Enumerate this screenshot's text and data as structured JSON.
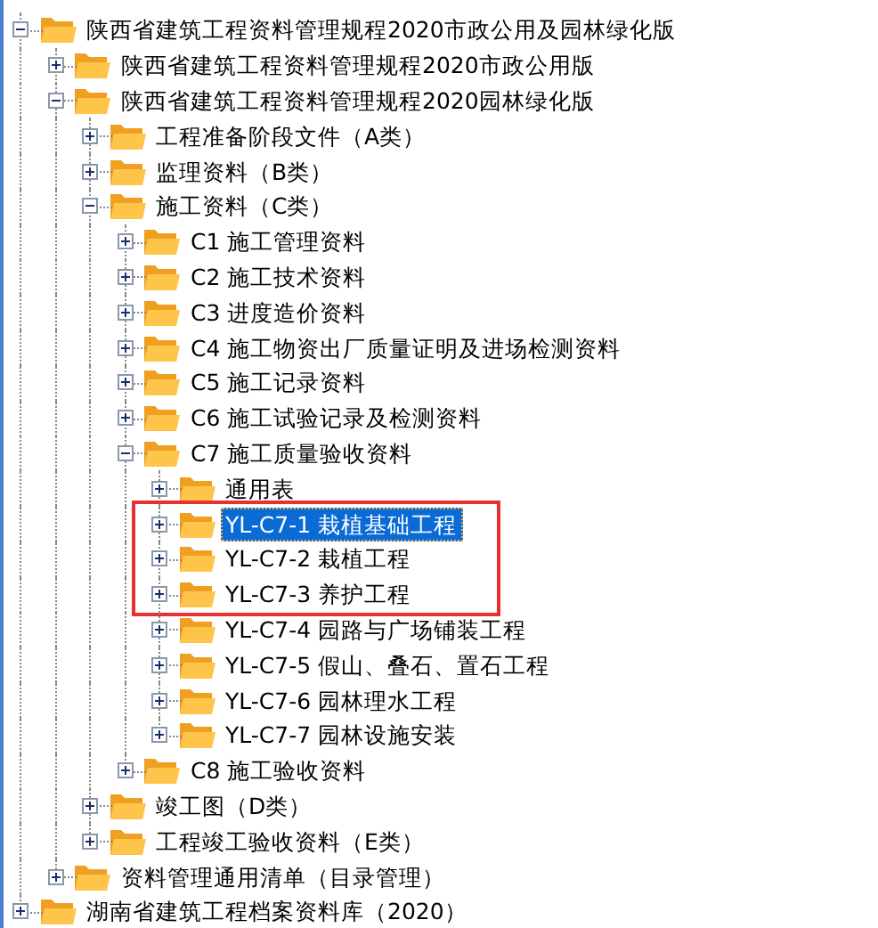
{
  "tree": [
    {
      "label": "陕西省建筑工程资料管理规程2020市政公用及园林绿化版",
      "expanded": true,
      "selected": false,
      "children": [
        {
          "label": "陕西省建筑工程资料管理规程2020市政公用版",
          "expanded": false,
          "selected": false
        },
        {
          "label": "陕西省建筑工程资料管理规程2020园林绿化版",
          "expanded": true,
          "selected": false,
          "children": [
            {
              "label": "工程准备阶段文件（A类）",
              "expanded": false,
              "selected": false
            },
            {
              "label": "监理资料（B类）",
              "expanded": false,
              "selected": false
            },
            {
              "label": "施工资料（C类）",
              "expanded": true,
              "selected": false,
              "children": [
                {
                  "label": "C1 施工管理资料",
                  "expanded": false,
                  "selected": false
                },
                {
                  "label": "C2 施工技术资料",
                  "expanded": false,
                  "selected": false
                },
                {
                  "label": "C3 进度造价资料",
                  "expanded": false,
                  "selected": false
                },
                {
                  "label": "C4 施工物资出厂质量证明及进场检测资料",
                  "expanded": false,
                  "selected": false
                },
                {
                  "label": "C5 施工记录资料",
                  "expanded": false,
                  "selected": false
                },
                {
                  "label": "C6 施工试验记录及检测资料",
                  "expanded": false,
                  "selected": false
                },
                {
                  "label": "C7 施工质量验收资料",
                  "expanded": true,
                  "selected": false,
                  "children": [
                    {
                      "label": "通用表",
                      "expanded": false,
                      "selected": false,
                      "marked": false
                    },
                    {
                      "label": "YL-C7-1 栽植基础工程",
                      "expanded": false,
                      "selected": true,
                      "marked": true
                    },
                    {
                      "label": "YL-C7-2 栽植工程",
                      "expanded": false,
                      "selected": false,
                      "marked": true
                    },
                    {
                      "label": "YL-C7-3 养护工程",
                      "expanded": false,
                      "selected": false,
                      "marked": true
                    },
                    {
                      "label": "YL-C7-4 园路与广场铺装工程",
                      "expanded": false,
                      "selected": false,
                      "marked": false
                    },
                    {
                      "label": "YL-C7-5 假山、叠石、置石工程",
                      "expanded": false,
                      "selected": false,
                      "marked": false
                    },
                    {
                      "label": "YL-C7-6 园林理水工程",
                      "expanded": false,
                      "selected": false,
                      "marked": false
                    },
                    {
                      "label": "YL-C7-7 园林设施安装",
                      "expanded": false,
                      "selected": false,
                      "marked": false
                    }
                  ]
                },
                {
                  "label": "C8 施工验收资料",
                  "expanded": false,
                  "selected": false
                }
              ]
            },
            {
              "label": "竣工图（D类）",
              "expanded": false,
              "selected": false
            },
            {
              "label": "工程竣工验收资料（E类）",
              "expanded": false,
              "selected": false
            }
          ]
        },
        {
          "label": "资料管理通用清单（目录管理）",
          "expanded": false,
          "selected": false
        }
      ]
    },
    {
      "label": "湖南省建筑工程档案资料库（2020）",
      "expanded": false,
      "selected": false
    }
  ]
}
